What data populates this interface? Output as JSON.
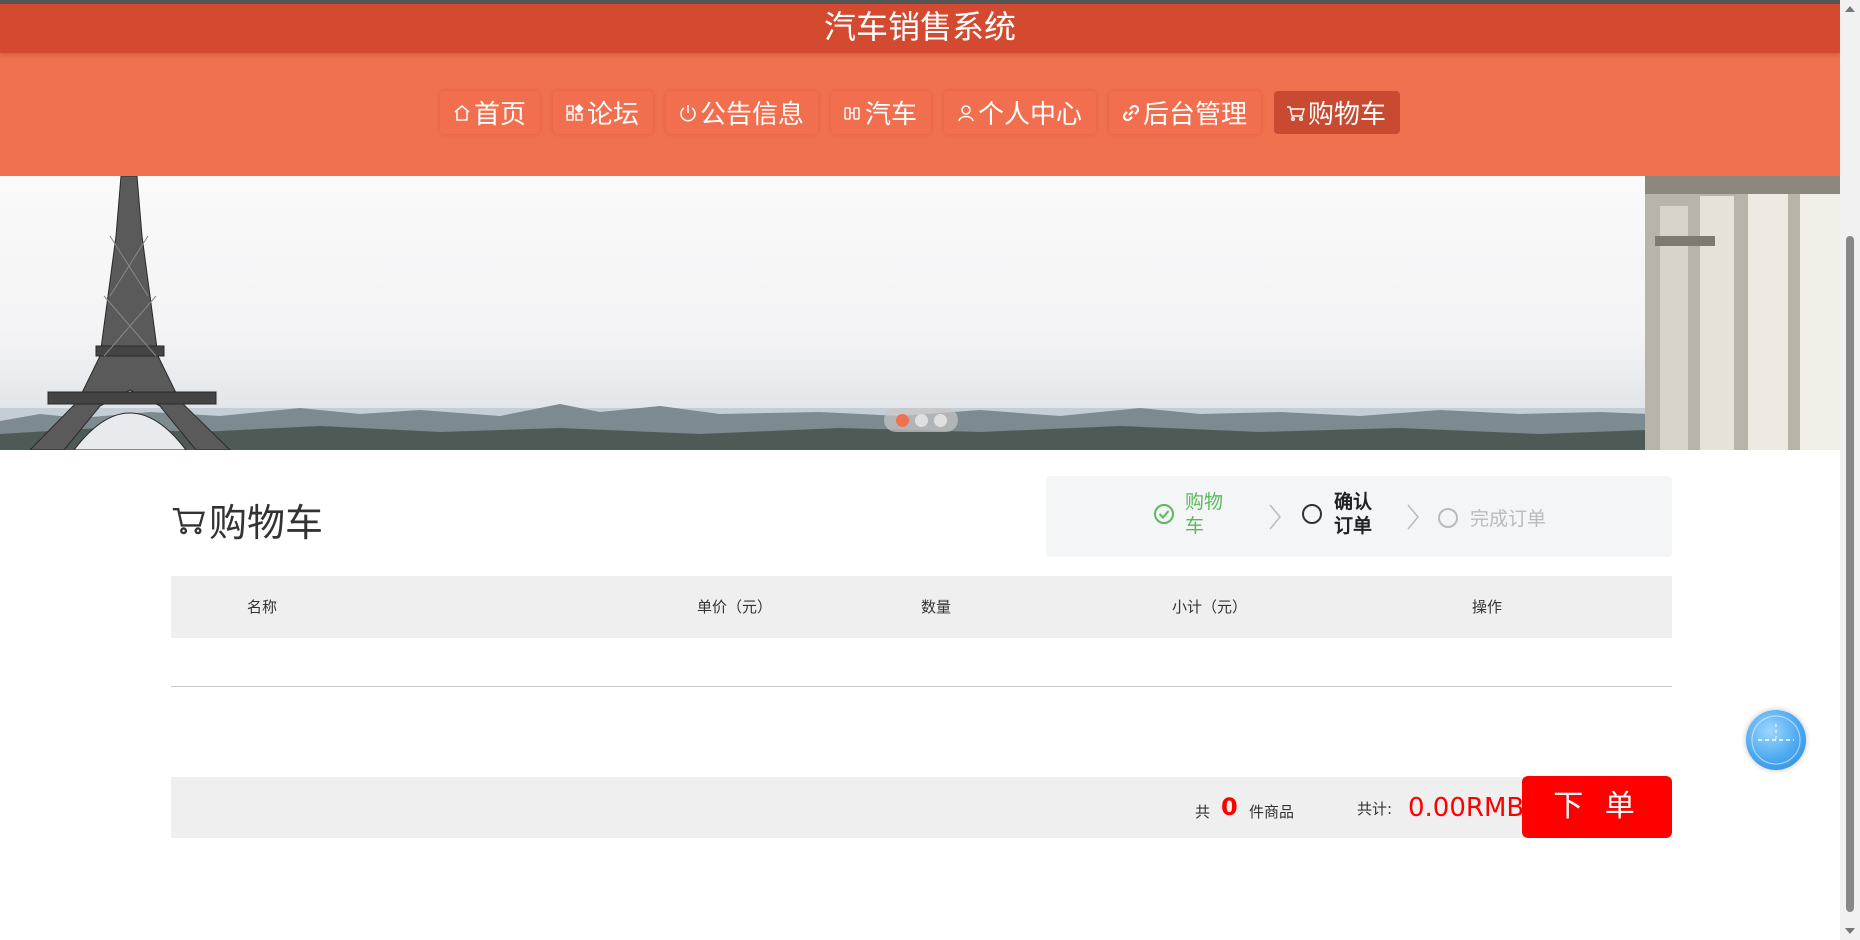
{
  "header": {
    "title": "汽车销售系统"
  },
  "nav": {
    "items": [
      {
        "label": "首页",
        "icon": "home-icon"
      },
      {
        "label": "论坛",
        "icon": "apps-icon"
      },
      {
        "label": "公告信息",
        "icon": "power-icon"
      },
      {
        "label": "汽车",
        "icon": "car-icon"
      },
      {
        "label": "个人中心",
        "icon": "user-icon"
      },
      {
        "label": "后台管理",
        "icon": "link-icon"
      },
      {
        "label": "购物车",
        "icon": "cart-icon",
        "active": true
      }
    ]
  },
  "banner": {
    "slide_count": 3,
    "active_slide": 1
  },
  "cart": {
    "heading": "购物车",
    "steps": [
      {
        "label": "购物车",
        "state": "done"
      },
      {
        "label": "确认订单",
        "state": "current"
      },
      {
        "label": "完成订单",
        "state": "pending"
      }
    ],
    "columns": [
      "名称",
      "单价（元）",
      "数量",
      "小计（元）",
      "操作"
    ],
    "rows": [],
    "footer": {
      "count_prefix": "共",
      "count": "0",
      "count_suffix": "件商品",
      "total_label": "共计:",
      "total_value": "0.00RMB",
      "order_button": "下 单"
    }
  },
  "colors": {
    "header": "#d44a30",
    "nav": "#f07150",
    "active_nav": "#c84a30",
    "step_done": "#5cb85c",
    "price": "#ff0000",
    "order_button": "#ff0000"
  },
  "float_widget": {
    "icon": "clock-icon"
  }
}
